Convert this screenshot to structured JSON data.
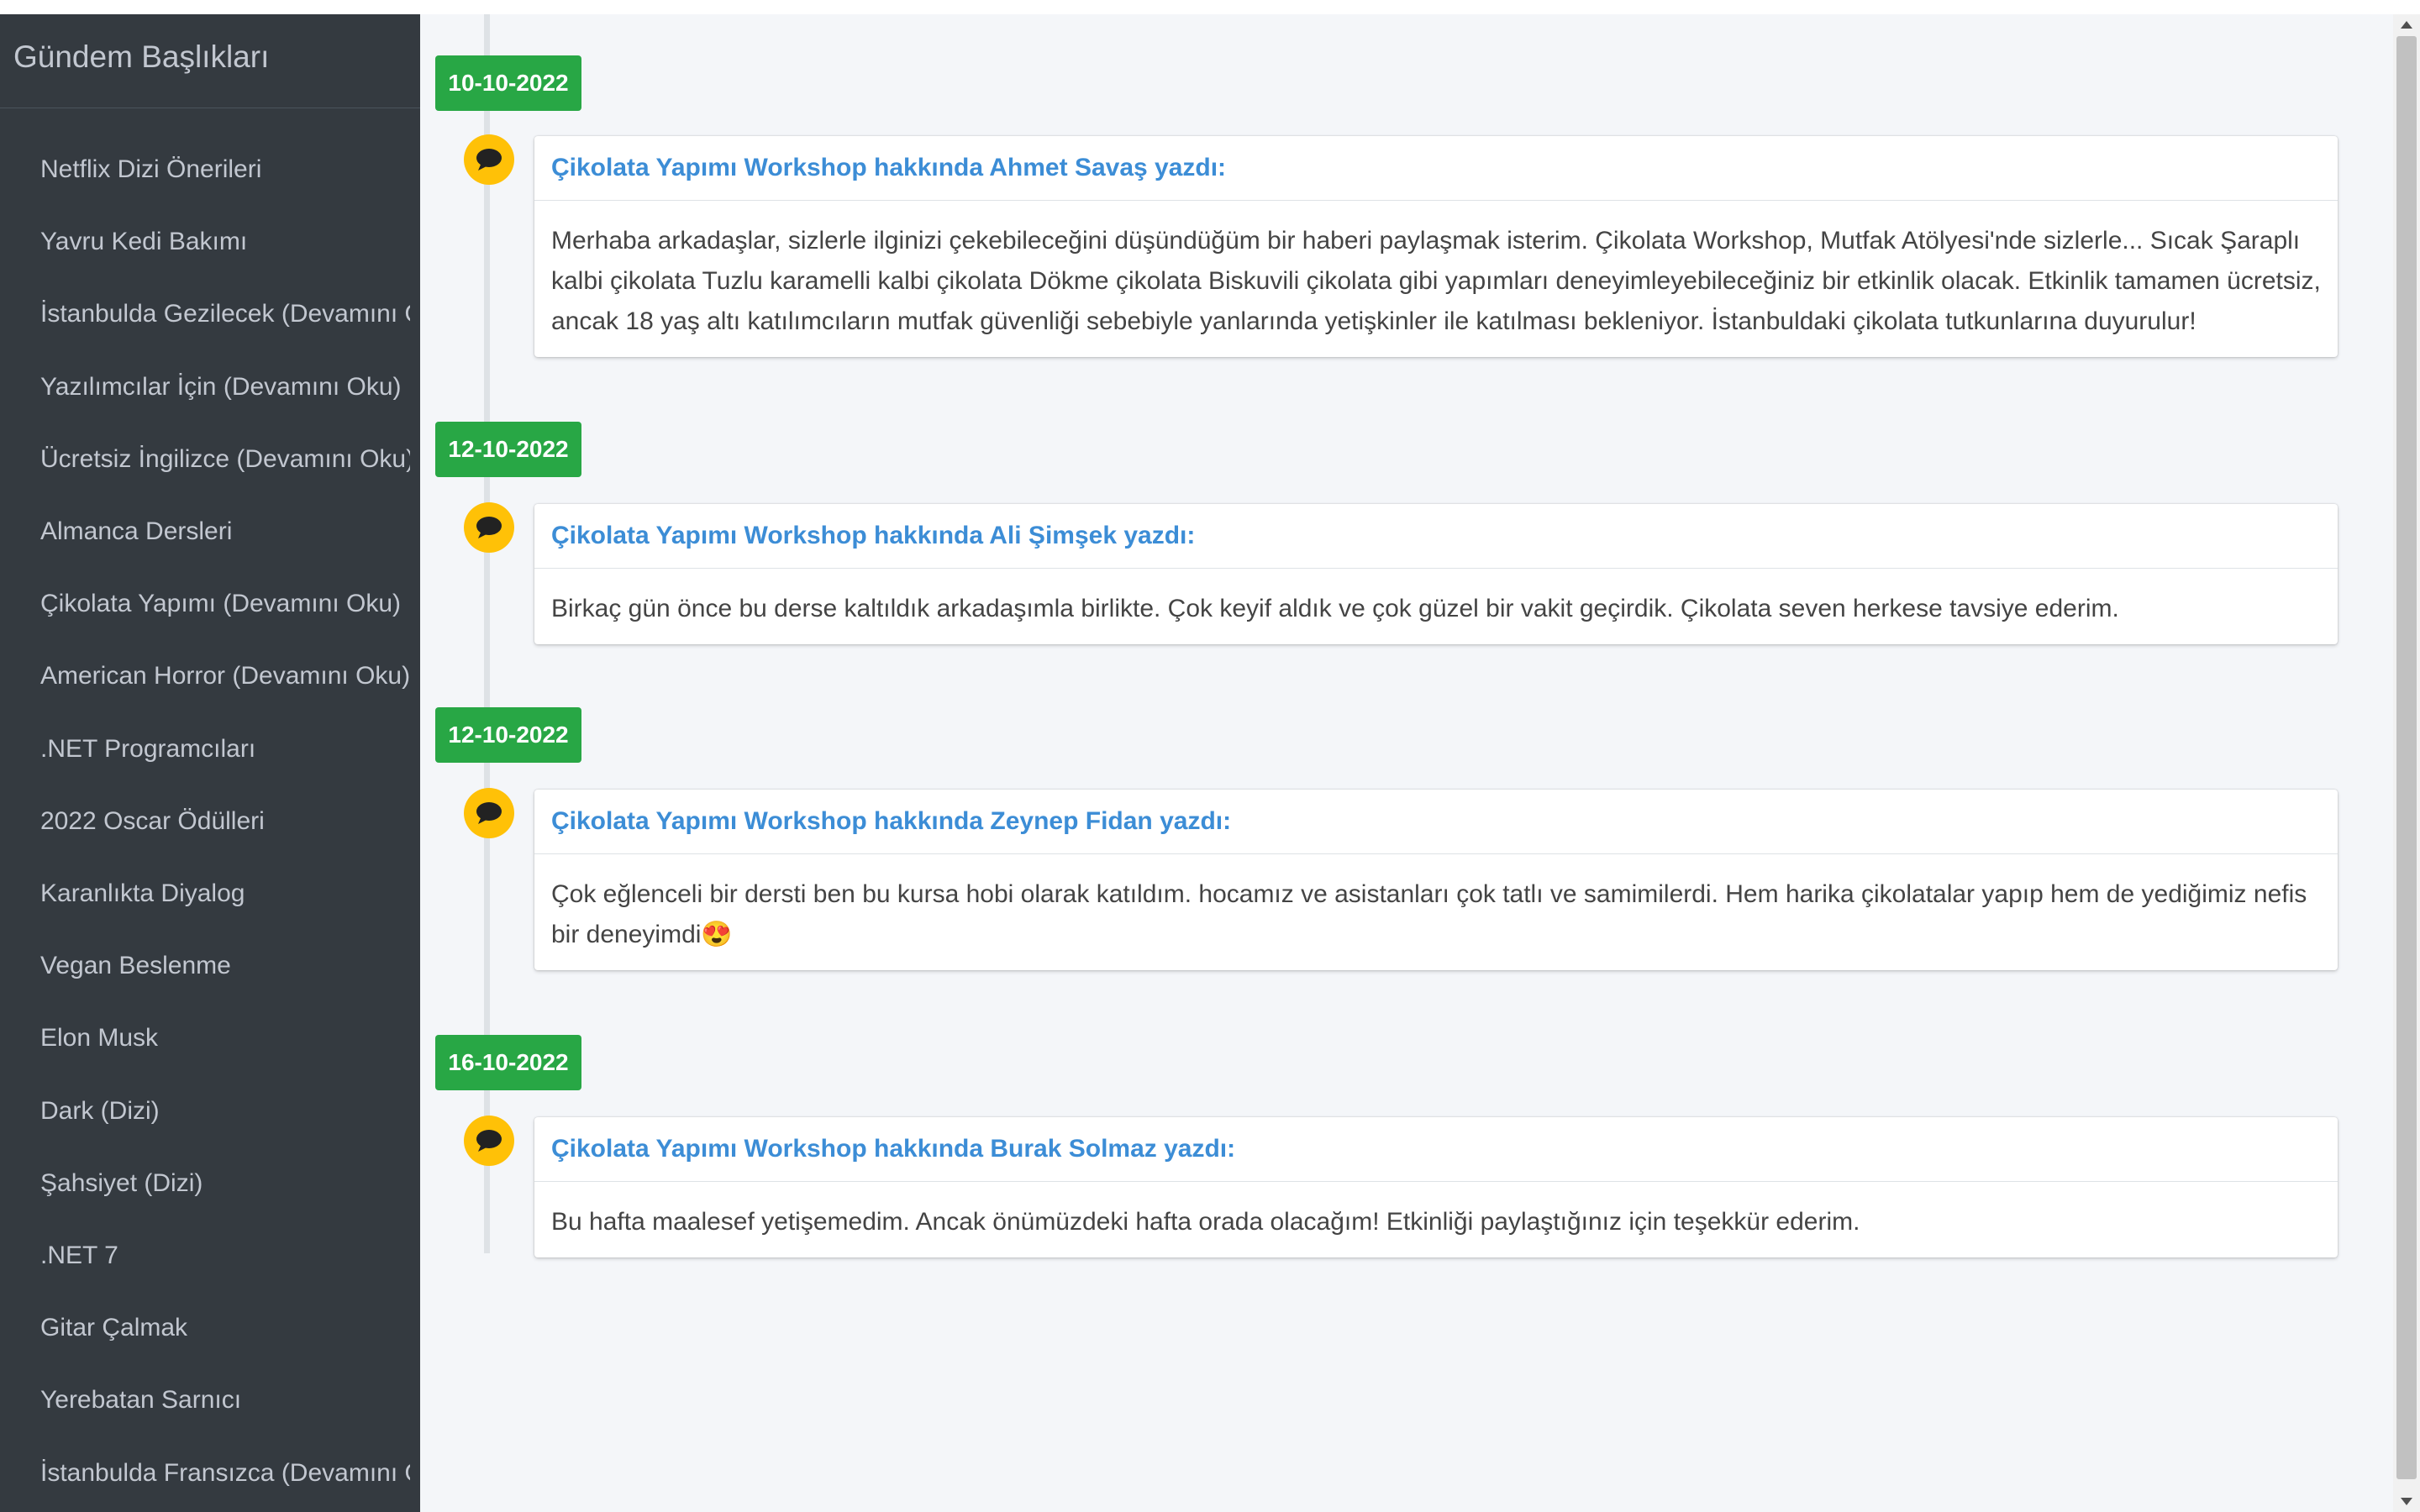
{
  "sidebar": {
    "title": "Gündem Başlıkları",
    "items": [
      "Netflix Dizi Önerileri",
      "Yavru Kedi Bakımı",
      "İstanbulda Gezilecek (Devamını Oku)",
      "Yazılımcılar İçin (Devamını Oku)",
      "Ücretsiz İngilizce (Devamını Oku)",
      "Almanca Dersleri",
      "Çikolata Yapımı (Devamını Oku)",
      "American Horror (Devamını Oku)",
      ".NET Programcıları",
      "2022 Oscar Ödülleri",
      "Karanlıkta Diyalog",
      "Vegan Beslenme",
      "Elon Musk",
      "Dark (Dizi)",
      "Şahsiyet (Dizi)",
      ".NET 7",
      "Gitar Çalmak",
      "Yerebatan Sarnıcı",
      "İstanbulda Fransızca (Devamını Oku)"
    ]
  },
  "timeline": [
    {
      "date": "10-10-2022",
      "title": "Çikolata Yapımı Workshop hakkında Ahmet Savaş yazdı:",
      "body": "Merhaba arkadaşlar, sizlerle ilginizi çekebileceğini düşündüğüm bir haberi paylaşmak isterim. Çikolata Workshop, Mutfak Atölyesi'nde sizlerle... Sıcak Şaraplı kalbi çikolata Tuzlu karamelli kalbi çikolata Dökme çikolata Biskuvili çikolata gibi yapımları deneyimleyebileceğiniz bir etkinlik olacak. Etkinlik tamamen ücretsiz, ancak 18 yaş altı katılımcıların mutfak güvenliği sebebiyle yanlarında yetişkinler ile katılması bekleniyor. İstanbuldaki çikolata tutkunlarına duyurulur!"
    },
    {
      "date": "12-10-2022",
      "title": "Çikolata Yapımı Workshop hakkında Ali Şimşek yazdı:",
      "body": "Birkaç gün önce bu derse kaltıldık arkadaşımla birlikte. Çok keyif aldık ve çok güzel bir vakit geçirdik. Çikolata seven herkese tavsiye ederim."
    },
    {
      "date": "12-10-2022",
      "title": "Çikolata Yapımı Workshop hakkında Zeynep Fidan yazdı:",
      "body": "Çok eğlenceli bir dersti ben bu kursa hobi olarak katıldım. hocamız ve asistanları çok tatlı ve samimilerdi. Hem harika çikolatalar yapıp hem de yediğimiz nefis bir deneyimdi😍"
    },
    {
      "date": "16-10-2022",
      "title": "Çikolata Yapımı Workshop hakkında Burak Solmaz yazdı:",
      "body": "Bu hafta maalesef yetişemedim. Ancak önümüzdeki hafta orada olacağım! Etkinliği paylaştığınız için teşekkür ederim."
    }
  ],
  "icons": {
    "timeline": "comment-icon"
  },
  "colors": {
    "date_badge": "#28a745",
    "icon_bg": "#ffc107",
    "title_link": "#3c8dd6",
    "sidebar_bg": "#343a40"
  }
}
